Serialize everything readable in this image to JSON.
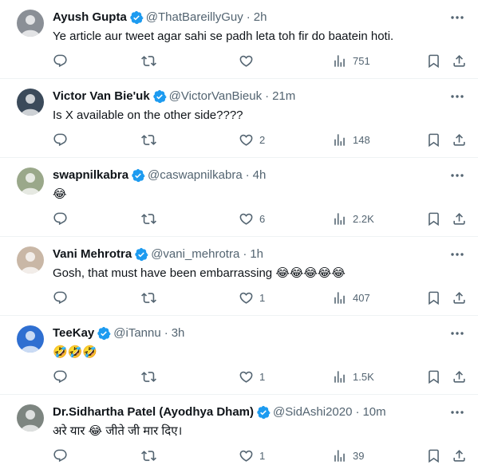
{
  "replies": [
    {
      "name": "Ayush Gupta",
      "handle": "@ThatBareillyGuy",
      "dot": "·",
      "time": "2h",
      "text": "Ye article aur tweet agar sahi se padh leta toh fir do baatein hoti.",
      "likes": "",
      "views": "751",
      "avatar_color": "#8a8f96",
      "avatar_icon": "avatar-person-icon"
    },
    {
      "name": "Victor Van Bie'uk",
      "handle": "@VictorVanBieuk",
      "dot": "·",
      "time": "21m",
      "text": "Is X available on the other side????",
      "likes": "2",
      "views": "148",
      "avatar_color": "#3b4a5a",
      "avatar_icon": "avatar-skull-icon"
    },
    {
      "name": "swapnilkabra",
      "handle": "@caswapnilkabra",
      "dot": "·",
      "time": "4h",
      "text": "😂",
      "likes": "6",
      "views": "2.2K",
      "avatar_color": "#9aa88a",
      "avatar_icon": "avatar-group-photo-icon"
    },
    {
      "name": "Vani Mehrotra",
      "handle": "@vani_mehrotra",
      "dot": "·",
      "time": "1h",
      "text": "Gosh, that must have been embarrassing 😂😂😂😂😂",
      "likes": "1",
      "views": "407",
      "avatar_color": "#c9b7a6",
      "avatar_icon": "avatar-person-icon"
    },
    {
      "name": "TeeKay",
      "handle": "@iTannu",
      "dot": "·",
      "time": "3h",
      "text": "🤣🤣🤣",
      "likes": "1",
      "views": "1.5K",
      "avatar_color": "#2f6fd1",
      "avatar_icon": "avatar-cartoon-icon"
    },
    {
      "name": "Dr.Sidhartha Patel (Ayodhya Dham)",
      "handle": "@SidAshi2020",
      "dot": "·",
      "time": "10m",
      "text": "अरे यार 😂 जीते जी मार दिए।",
      "likes": "1",
      "views": "39",
      "avatar_color": "#7d8580",
      "avatar_icon": "avatar-person-icon"
    }
  ],
  "colors": {
    "verified_badge": "#1d9bf0",
    "secondary_text": "#536471",
    "primary_text": "#0f1419",
    "divider": "#eff3f4"
  }
}
